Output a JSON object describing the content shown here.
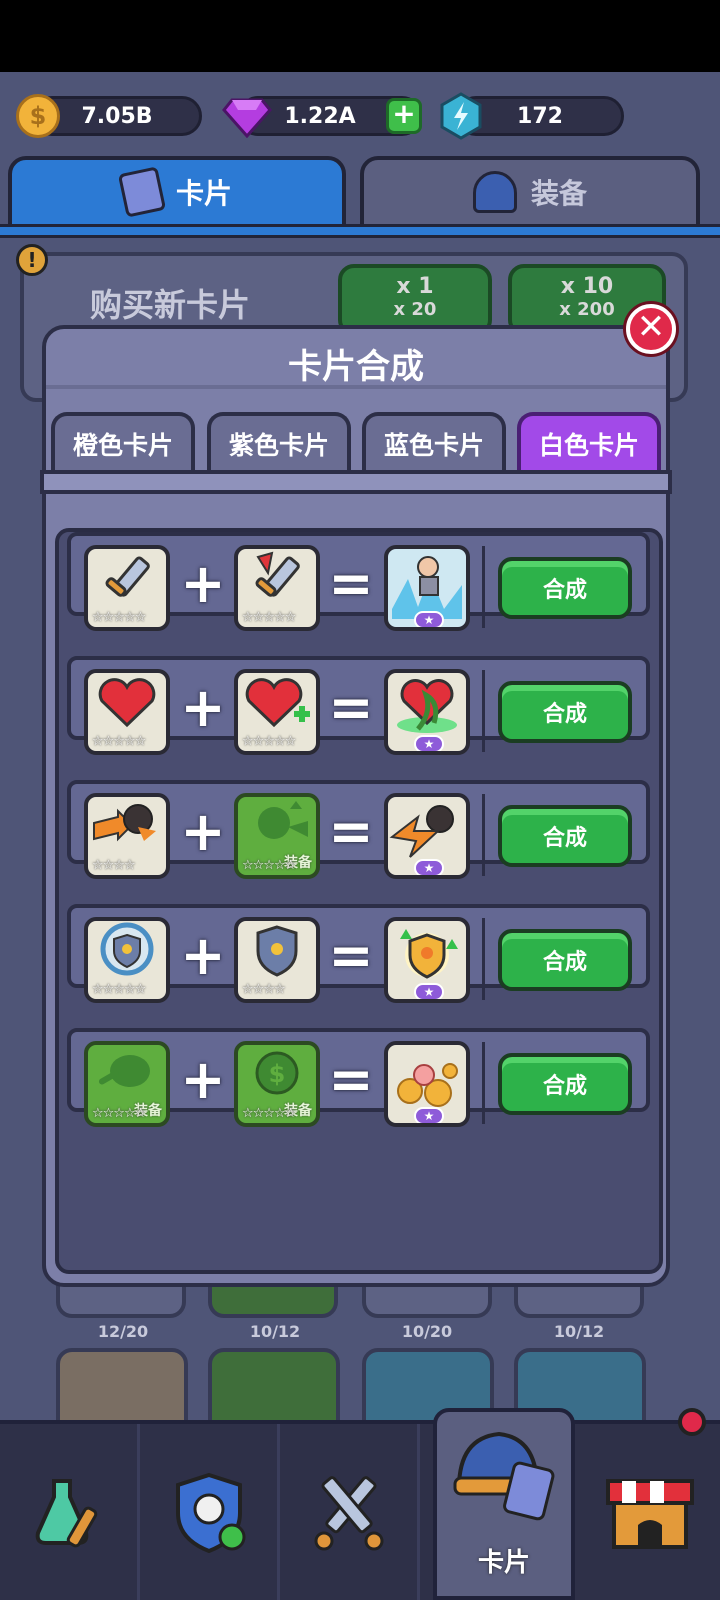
{
  "currency": {
    "coins": "7.05B",
    "gems": "1.22A",
    "energy": "172"
  },
  "top_tabs": [
    {
      "label": "卡片"
    },
    {
      "label": "装备"
    }
  ],
  "shop": {
    "title": "购买新卡片",
    "buy_one": {
      "qty": "x 1",
      "cost": "x 20"
    },
    "buy_ten": {
      "qty": "x 10",
      "cost": "x 200"
    }
  },
  "modal": {
    "title": "卡片合成",
    "tabs": [
      {
        "label": "橙色卡片"
      },
      {
        "label": "紫色卡片"
      },
      {
        "label": "蓝色卡片"
      },
      {
        "label": "白色卡片"
      }
    ],
    "active_tab": "白色卡片",
    "recipes": [
      {
        "a_icon": "sword-icon",
        "a_stars": "☆☆☆☆☆",
        "b_icon": "red-sword-icon",
        "b_stars": "☆☆☆☆☆",
        "b_tag": "",
        "result_icon": "ice-warrior-icon",
        "button": "合成"
      },
      {
        "a_icon": "heart-icon",
        "a_stars": "☆☆☆☆☆",
        "b_icon": "heart-plus-icon",
        "b_stars": "☆☆☆☆☆",
        "b_tag": "",
        "result_icon": "vine-heart-icon",
        "button": "合成"
      },
      {
        "a_icon": "bomb-arrow-icon",
        "a_stars": "☆☆☆☆",
        "b_icon": "green-bomb-icon",
        "b_stars": "☆☆☆☆☆",
        "b_tag": "装备",
        "result_icon": "bomb-lightning-icon",
        "button": "合成"
      },
      {
        "a_icon": "shield-ring-icon",
        "a_stars": "☆☆☆☆☆",
        "b_icon": "shield-star-icon",
        "b_stars": "☆☆☆☆",
        "b_tag": "",
        "result_icon": "gold-shield-icon",
        "button": "合成"
      },
      {
        "a_icon": "meat-icon",
        "a_stars": "☆☆☆☆☆",
        "a_tag": "装备",
        "b_icon": "coin-icon",
        "b_stars": "☆☆☆☆☆",
        "b_tag": "装备",
        "result_icon": "coin-pile-icon",
        "button": "合成"
      }
    ]
  },
  "behind_counts": [
    "12/20",
    "10/12",
    "10/20",
    "10/12"
  ],
  "bottom_nav": {
    "active_label": "卡片"
  }
}
